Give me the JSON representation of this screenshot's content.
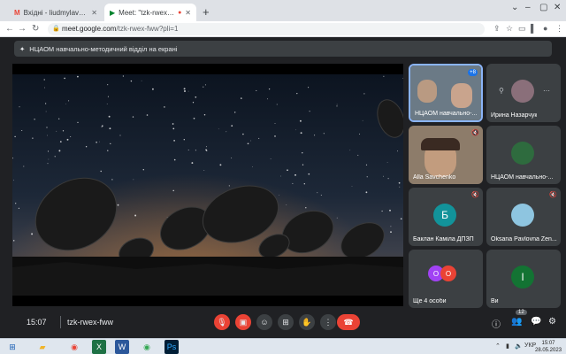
{
  "browser": {
    "tabs": [
      {
        "title": "Вхідні - liudmylavaksh@gmail.c...",
        "active": false
      },
      {
        "title": "Meet: \"tzk-rwex-fww\"",
        "active": true
      }
    ],
    "url_host": "meet.google.com",
    "url_path": "/tzk-rwex-fww?pli=1"
  },
  "meet": {
    "presenting_label": "НЦАОМ навчально-методичний відділ на екрані",
    "time": "15:07",
    "meeting_code": "tzk-rwex-fww",
    "people_count": "12",
    "participants": [
      {
        "name": "НЦАОМ навчально-...",
        "extra": "+8"
      },
      {
        "name": "Ирина Назарчук"
      },
      {
        "name": "Alla Savchenko"
      },
      {
        "name": "НЦАОМ навчально-..."
      },
      {
        "name": "Баклан Каміла ДПЗП",
        "initial": "Б"
      },
      {
        "name": "Oksana Pavlovna Zen..."
      },
      {
        "name": "Ще 4 особи"
      },
      {
        "name": "Ви",
        "initial": "І"
      }
    ],
    "colors": {
      "mic_off_red": "#ea4335",
      "speaker_border": "#8ab4f8",
      "avatar_teal": "#12939a",
      "avatar_green": "#137333"
    }
  },
  "taskbar": {
    "lang": "УКР",
    "clock_time": "15:07",
    "clock_date": "28.05.2023"
  }
}
